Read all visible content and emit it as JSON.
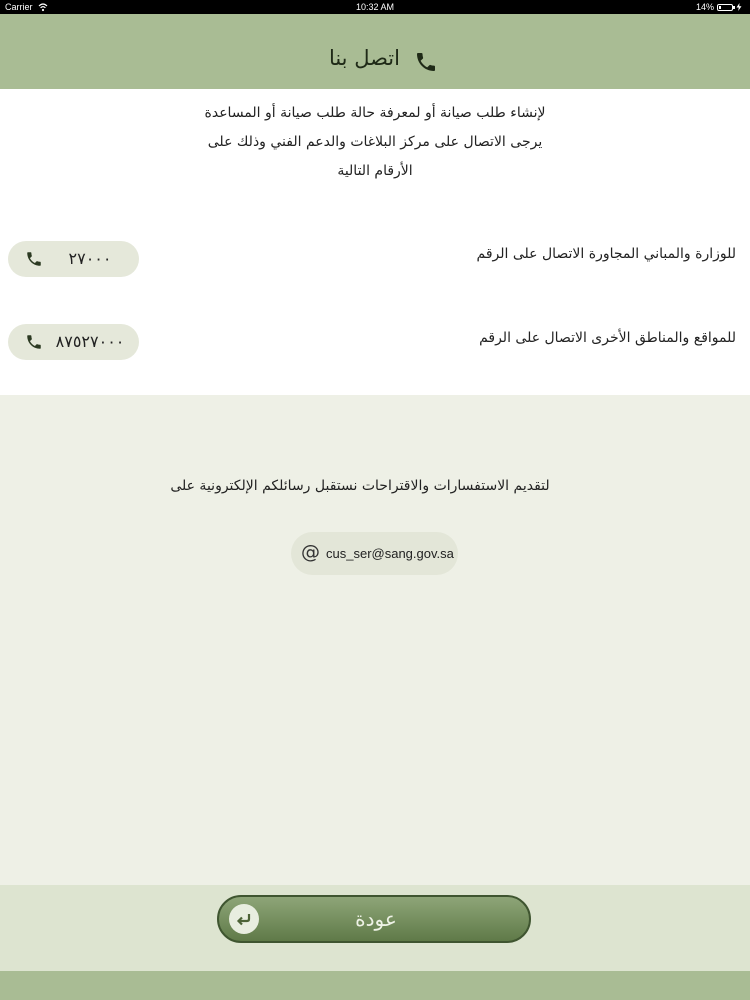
{
  "status_bar": {
    "carrier": "Carrier",
    "time": "10:32 AM",
    "battery": "14%"
  },
  "header": {
    "title": "اتصل بنا",
    "icon": "phone-icon"
  },
  "intro": {
    "line1": "لإنشاء طلب صيانة أو لمعرفة حالة طلب صيانة أو المساعدة",
    "line2": "يرجى الاتصال على مركز البلاغات والدعم الفني وذلك على",
    "line3": "الأرقام التالية"
  },
  "contacts": [
    {
      "label": "للوزارة والمباني المجاورة الاتصال على الرقم",
      "number": "٢٧٠٠٠",
      "icon": "phone-icon"
    },
    {
      "label": "للمواقع والمناطق الأخرى الاتصال على الرقم",
      "number": "٨٧٥٢٧٠٠٠",
      "icon": "phone-icon"
    }
  ],
  "email": {
    "label": "لتقديم الاستفسارات والاقتراحات نستقبل رسائلكم الإلكترونية على",
    "symbol": "@",
    "address": "cus_ser@sang.gov.sa"
  },
  "footer": {
    "back_label": "عودة",
    "back_icon": "return-arrow-icon"
  },
  "colors": {
    "header": "#a9bc94",
    "content": "#ffffff",
    "background": "#eef0e6",
    "button": "#6f8a58"
  }
}
